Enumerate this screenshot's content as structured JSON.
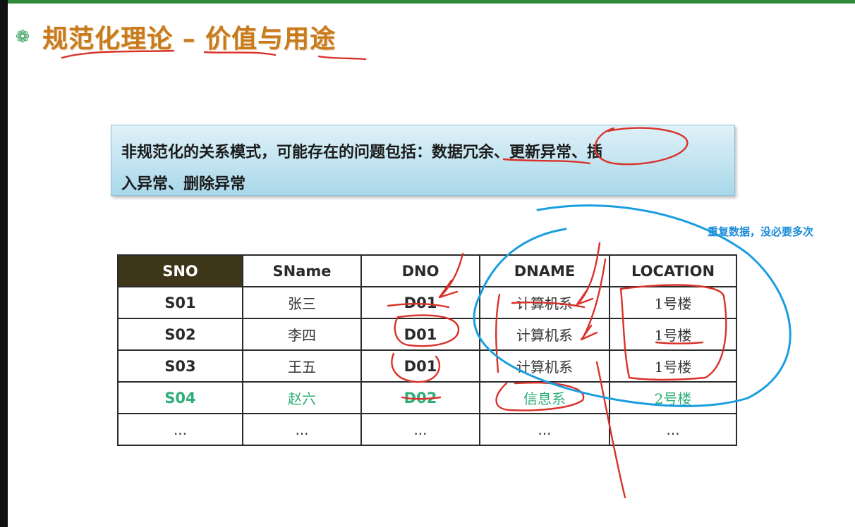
{
  "slide": {
    "title": "规范化理论 – 价值与用途",
    "bullet_icon": "gear-flower-icon",
    "callout_line1": "非规范化的关系模式，可能存在的问题包括：数据冗余、更新异常、插",
    "callout_line2": "入异常、删除异常"
  },
  "annotation": {
    "note": "重复数据，没必要多次",
    "ink_color_red": "#d8322a",
    "ink_color_blue": "#1a9ee0"
  },
  "table": {
    "headers": [
      "SNO",
      "SName",
      "DNO",
      "DNAME",
      "LOCATION"
    ],
    "rows": [
      [
        "S01",
        "张三",
        "D01",
        "计算机系",
        "1号楼"
      ],
      [
        "S02",
        "李四",
        "D01",
        "计算机系",
        "1号楼"
      ],
      [
        "S03",
        "王五",
        "D01",
        "计算机系",
        "1号楼"
      ],
      [
        "S04",
        "赵六",
        "D02",
        "信息系",
        "2号楼"
      ],
      [
        "...",
        "...",
        "...",
        "...",
        "..."
      ]
    ],
    "highlight_row_color": "#2eae78"
  },
  "colors": {
    "title": "#c87a1c",
    "callout_bg": "#bfe3f0",
    "header_dark": "#3e3618",
    "top_bar": "#2f8a3a"
  }
}
